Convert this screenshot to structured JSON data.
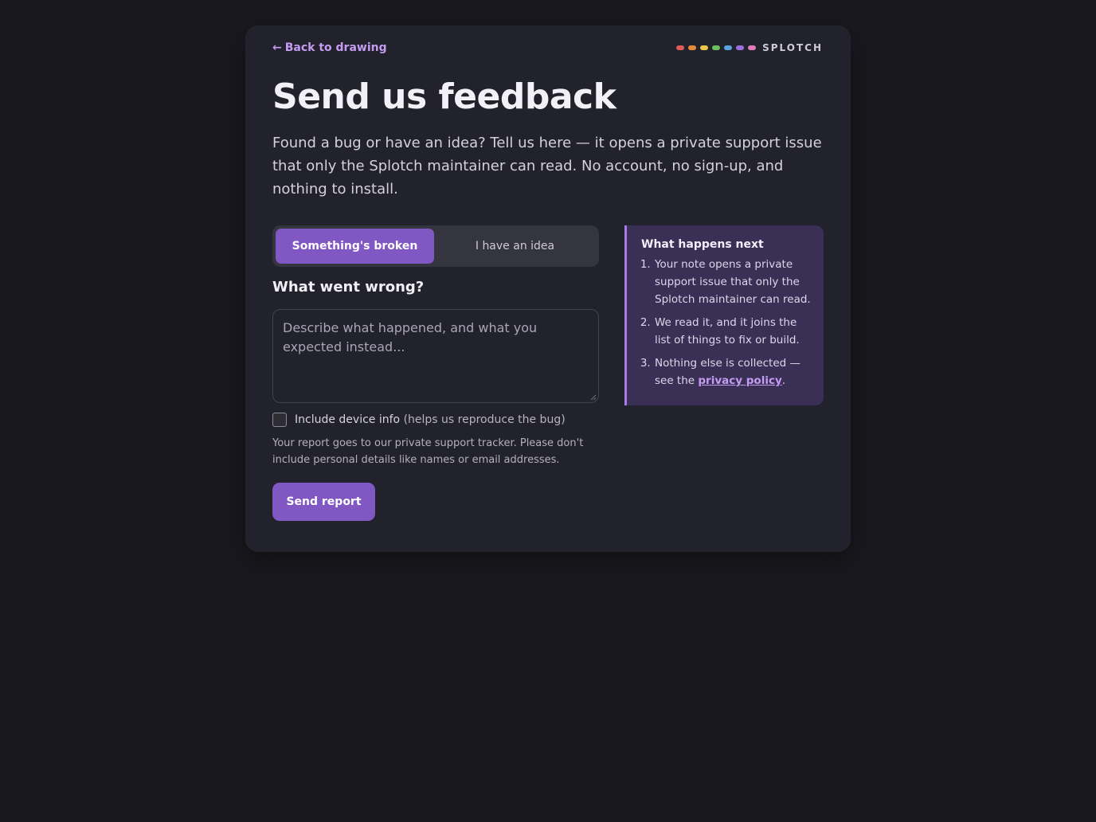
{
  "nav": {
    "back_arrow": "←",
    "back_label": "Back to drawing"
  },
  "brand": {
    "name": "SPLOTCH",
    "dot_colors": [
      "#e05a5a",
      "#e58a3d",
      "#e9c64a",
      "#6cbf5e",
      "#5aa3e0",
      "#9b6fe0",
      "#e07ab8"
    ]
  },
  "hero": {
    "title": "Send us feedback",
    "intro": "Found a bug or have an idea? Tell us here — it opens a private support issue that only the Splotch maintainer can read. No account, no sign-up, and nothing to install."
  },
  "form": {
    "tabs": [
      {
        "label": "Something's broken",
        "selected": true
      },
      {
        "label": "I have an idea",
        "selected": false
      }
    ],
    "question_label": "What went wrong?",
    "textarea_value": "",
    "textarea_placeholder": "Describe what happened, and what you expected instead...",
    "checkbox": {
      "checked": false,
      "label": "Include device info",
      "hint": "(helps us reproduce the bug)"
    },
    "privacy_note": "Your report goes to our private support tracker. Please don't include personal details like names or email addresses.",
    "submit_label": "Send report"
  },
  "sidebar": {
    "title": "What happens next",
    "steps": [
      {
        "text": "Your note opens a private support issue that only the Splotch maintainer can read."
      },
      {
        "text": "We read it, and it joins the list of things to fix or build."
      },
      {
        "text_before": "Nothing else is collected — see the ",
        "link_label": "privacy policy",
        "text_after": "."
      }
    ]
  },
  "colors": {
    "accent": "#8157c4",
    "link": "#c49cf2",
    "page_background": "#18181e",
    "card_background": "#22222c",
    "sidebar_background": "#3a2f55"
  }
}
